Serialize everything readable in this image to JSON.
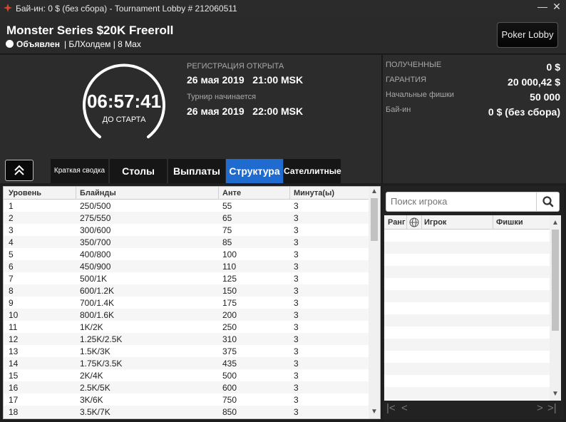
{
  "window": {
    "title": "Бай-ин: 0 $ (без сбора) - Tournament Lobby # 212060511",
    "minimize": "—",
    "close": "✕"
  },
  "header": {
    "name": "Monster Series $20K Freeroll",
    "status": "Объявлен",
    "details": "| БЛХолдем | 8 Max",
    "lobby_button": "Poker Lobby"
  },
  "timer": {
    "value": "06:57:41",
    "label": "ДО СТАРТА"
  },
  "schedule": {
    "reg_label": "РЕГИСТРАЦИЯ ОТКРЫТА",
    "reg_value": "26 мая 2019   21:00 MSK",
    "start_label": "Турнир начинается",
    "start_value": "26 мая 2019   22:00 MSK"
  },
  "prize": [
    {
      "label": "ПОЛУЧЕННЫЕ",
      "value": "0 $"
    },
    {
      "label": "ГАРАНТИЯ",
      "value": "20 000,42 $"
    },
    {
      "label": "Начальные фишки",
      "value": "50 000"
    },
    {
      "label": "Бай-ин",
      "value": "0 $ (без сбора)"
    }
  ],
  "tabs": [
    {
      "label": "Краткая сводка"
    },
    {
      "label": "Столы"
    },
    {
      "label": "Выплаты"
    },
    {
      "label": "Структура"
    },
    {
      "label": "Сателлитные"
    }
  ],
  "structure": {
    "columns": [
      "Уровень",
      "Блайнды",
      "Анте",
      "Минута(ы)"
    ],
    "rows": [
      [
        "1",
        "250/500",
        "55",
        "3"
      ],
      [
        "2",
        "275/550",
        "65",
        "3"
      ],
      [
        "3",
        "300/600",
        "75",
        "3"
      ],
      [
        "4",
        "350/700",
        "85",
        "3"
      ],
      [
        "5",
        "400/800",
        "100",
        "3"
      ],
      [
        "6",
        "450/900",
        "110",
        "3"
      ],
      [
        "7",
        "500/1K",
        "125",
        "3"
      ],
      [
        "8",
        "600/1.2K",
        "150",
        "3"
      ],
      [
        "9",
        "700/1.4K",
        "175",
        "3"
      ],
      [
        "10",
        "800/1.6K",
        "200",
        "3"
      ],
      [
        "11",
        "1K/2K",
        "250",
        "3"
      ],
      [
        "12",
        "1.25K/2.5K",
        "310",
        "3"
      ],
      [
        "13",
        "1.5K/3K",
        "375",
        "3"
      ],
      [
        "14",
        "1.75K/3.5K",
        "435",
        "3"
      ],
      [
        "15",
        "2K/4K",
        "500",
        "3"
      ],
      [
        "16",
        "2.5K/5K",
        "600",
        "3"
      ],
      [
        "17",
        "3K/6K",
        "750",
        "3"
      ],
      [
        "18",
        "3.5K/7K",
        "850",
        "3"
      ]
    ]
  },
  "players": {
    "search_placeholder": "Поиск игрока",
    "columns": [
      "Ранг",
      "Игрок",
      "Фишки"
    ]
  },
  "colors": {
    "active_tab": "#1f6bd0",
    "background": "#2c2c2c"
  }
}
